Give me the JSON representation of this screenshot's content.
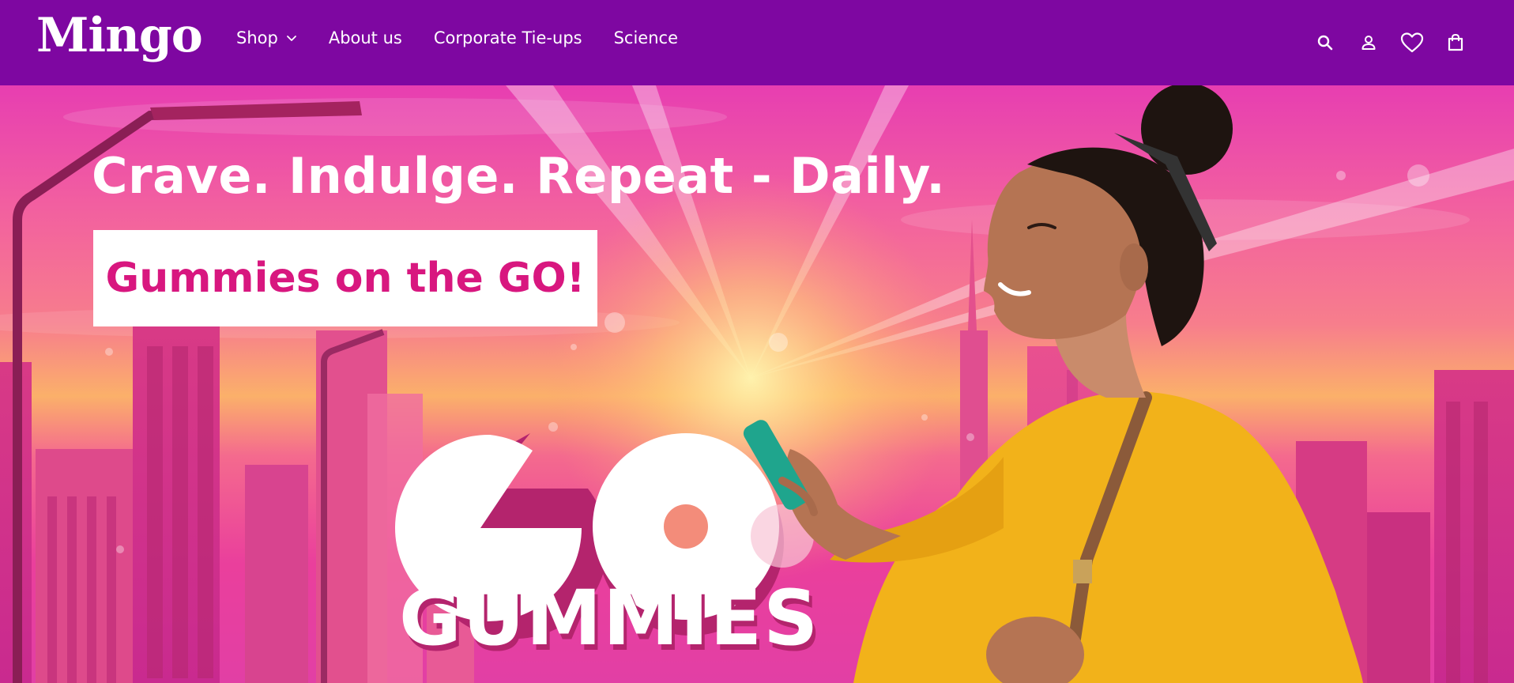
{
  "brand": {
    "logo_text": "Mingo"
  },
  "nav": {
    "items": [
      {
        "label": "Shop",
        "has_dropdown": true
      },
      {
        "label": "About us",
        "has_dropdown": false
      },
      {
        "label": "Corporate Tie-ups",
        "has_dropdown": false
      },
      {
        "label": "Science",
        "has_dropdown": false
      }
    ]
  },
  "header_icons": [
    "search-icon",
    "account-icon",
    "wishlist-heart-icon",
    "cart-bag-icon"
  ],
  "hero": {
    "headline": "Crave. Indulge. Repeat - Daily.",
    "tagline": "Gummies on the GO!",
    "product_art_text": "GO",
    "product_word": "GUMMIES"
  },
  "colors": {
    "header_bg": "#7e07a1",
    "tagline_text": "#d8177f",
    "sweater": "#f2b21a",
    "phone": "#1fa58d"
  }
}
